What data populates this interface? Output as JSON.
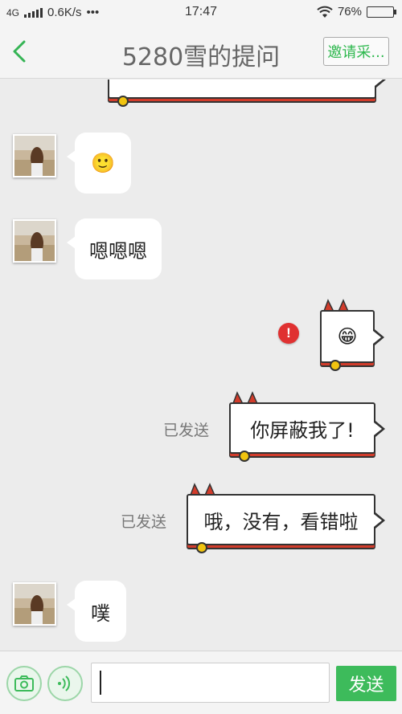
{
  "status_bar": {
    "network": "4G",
    "speed": "0.6K/s",
    "more": "•••",
    "time": "17:47",
    "battery": "76%",
    "battery_level": 0.76
  },
  "header": {
    "title": "5280雪的提问",
    "invite_label": "邀请采..."
  },
  "messages": [
    {
      "side": "right",
      "style": "cat",
      "text": ""
    },
    {
      "side": "left",
      "type": "emoji",
      "icon": "smile-emoji",
      "text": "🙂"
    },
    {
      "side": "left",
      "type": "text",
      "text": "嗯嗯嗯"
    },
    {
      "side": "right",
      "style": "cat",
      "type": "emoji",
      "icon": "grin-emoji",
      "text": "😁",
      "status": "failed"
    },
    {
      "side": "right",
      "style": "cat",
      "type": "text",
      "text": "你屏蔽我了!",
      "status": "已发送"
    },
    {
      "side": "right",
      "style": "cat",
      "type": "text",
      "text": "哦，没有，看错啦",
      "status": "已发送"
    },
    {
      "side": "left",
      "type": "text",
      "text": "噗"
    }
  ],
  "input_bar": {
    "camera_icon": "camera-icon",
    "voice_icon": "voice-icon",
    "input_value": "",
    "send_label": "发送"
  },
  "colors": {
    "accent": "#3dbb5b",
    "background": "#ececec",
    "cat_red": "#d23c2b",
    "error": "#e03131"
  }
}
